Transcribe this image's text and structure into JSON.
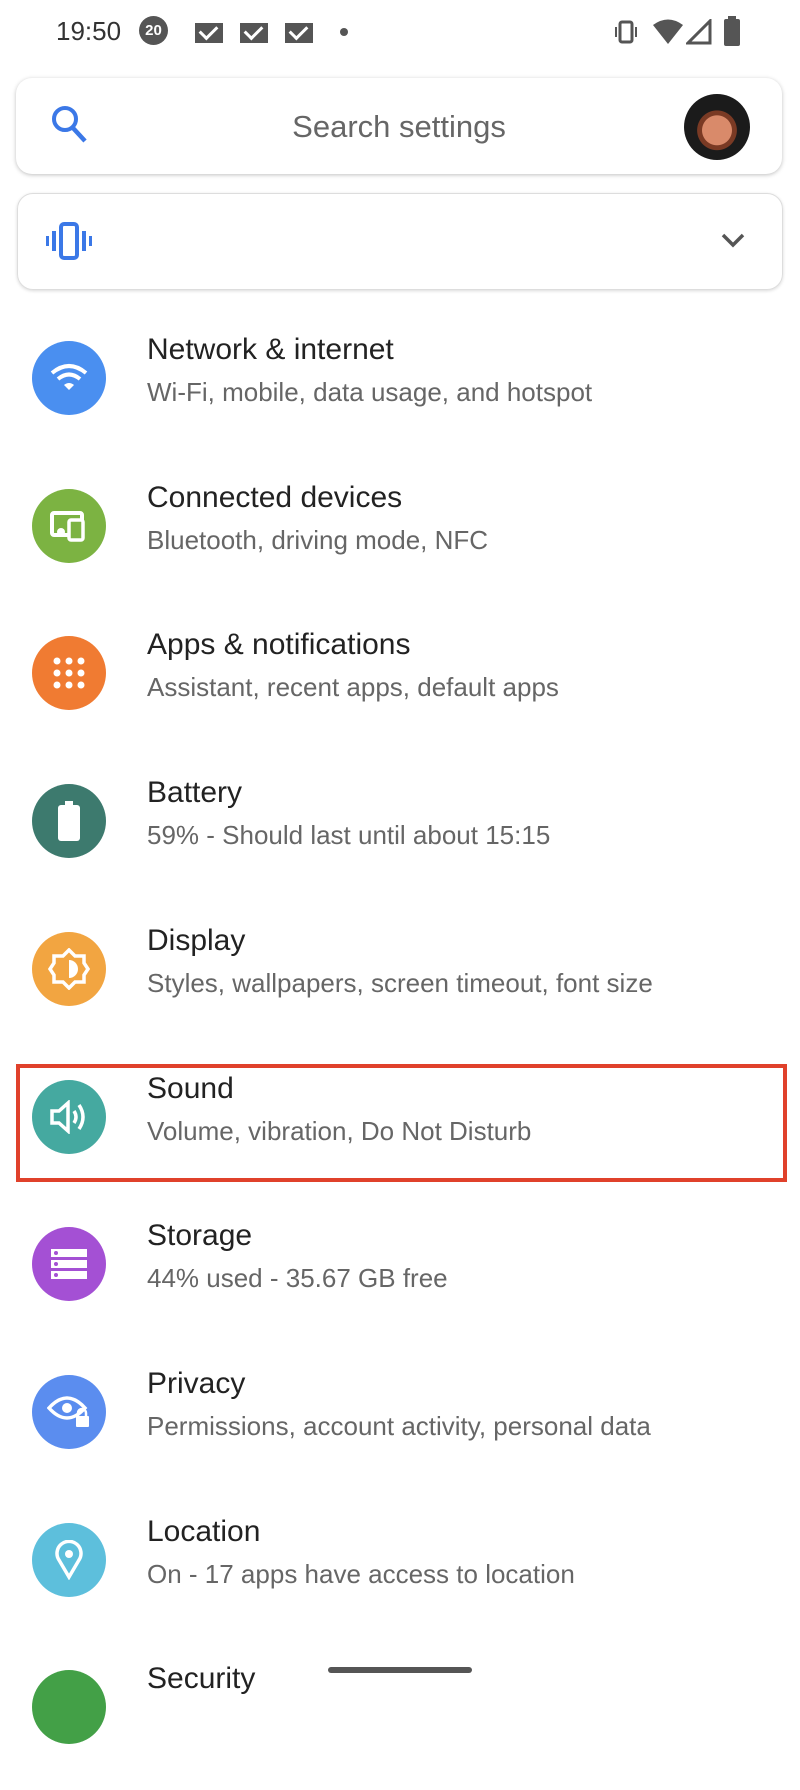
{
  "status_bar": {
    "time": "19:50",
    "badge": "20"
  },
  "search": {
    "placeholder": "Search settings"
  },
  "items": [
    {
      "title": "Network & internet",
      "subtitle": "Wi-Fi, mobile, data usage, and hotspot",
      "icon": "wifi-icon",
      "color": "#4a8ff0"
    },
    {
      "title": "Connected devices",
      "subtitle": "Bluetooth, driving mode, NFC",
      "icon": "devices-icon",
      "color": "#7cb342"
    },
    {
      "title": "Apps & notifications",
      "subtitle": "Assistant, recent apps, default apps",
      "icon": "apps-icon",
      "color": "#f07b32"
    },
    {
      "title": "Battery",
      "subtitle": "59% - Should last until about 15:15",
      "icon": "battery-icon",
      "color": "#3d7a6e"
    },
    {
      "title": "Display",
      "subtitle": "Styles, wallpapers, screen timeout, font size",
      "icon": "brightness-icon",
      "color": "#f2a541"
    },
    {
      "title": "Sound",
      "subtitle": "Volume, vibration, Do Not Disturb",
      "icon": "volume-icon",
      "color": "#45a9a0"
    },
    {
      "title": "Storage",
      "subtitle": "44% used - 35.67 GB free",
      "icon": "storage-icon",
      "color": "#a450d4"
    },
    {
      "title": "Privacy",
      "subtitle": "Permissions, account activity, personal data",
      "icon": "privacy-eye-icon",
      "color": "#5b8def"
    },
    {
      "title": "Location",
      "subtitle": "On - 17 apps have access to location",
      "icon": "location-pin-icon",
      "color": "#5dbfdc"
    },
    {
      "title": "Security",
      "subtitle": "",
      "icon": "security-icon",
      "color": "#43a047"
    }
  ],
  "highlight_color": "#e0412b"
}
